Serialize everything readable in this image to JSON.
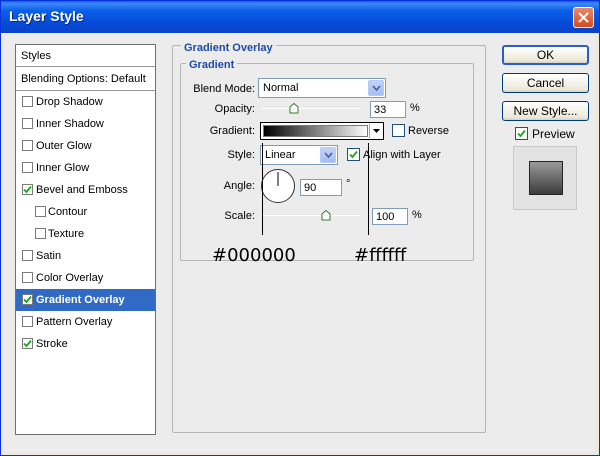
{
  "window": {
    "title": "Layer Style"
  },
  "styles_list": {
    "header": "Styles",
    "blending": "Blending Options: Default",
    "items": [
      {
        "label": "Drop Shadow",
        "checked": false,
        "sub": false,
        "selected": false
      },
      {
        "label": "Inner Shadow",
        "checked": false,
        "sub": false,
        "selected": false
      },
      {
        "label": "Outer Glow",
        "checked": false,
        "sub": false,
        "selected": false
      },
      {
        "label": "Inner Glow",
        "checked": false,
        "sub": false,
        "selected": false
      },
      {
        "label": "Bevel and Emboss",
        "checked": true,
        "sub": false,
        "selected": false
      },
      {
        "label": "Contour",
        "checked": false,
        "sub": true,
        "selected": false
      },
      {
        "label": "Texture",
        "checked": false,
        "sub": true,
        "selected": false
      },
      {
        "label": "Satin",
        "checked": false,
        "sub": false,
        "selected": false
      },
      {
        "label": "Color Overlay",
        "checked": false,
        "sub": false,
        "selected": false
      },
      {
        "label": "Gradient Overlay",
        "checked": true,
        "sub": false,
        "selected": true
      },
      {
        "label": "Pattern Overlay",
        "checked": false,
        "sub": false,
        "selected": false
      },
      {
        "label": "Stroke",
        "checked": true,
        "sub": false,
        "selected": false
      }
    ]
  },
  "gradient_overlay": {
    "group_title": "Gradient Overlay",
    "section_title": "Gradient",
    "blend_mode_label": "Blend Mode:",
    "blend_mode_value": "Normal",
    "opacity_label": "Opacity:",
    "opacity_value": "33",
    "opacity_unit": "%",
    "gradient_label": "Gradient:",
    "reverse_label": "Reverse",
    "reverse_checked": false,
    "style_label": "Style:",
    "style_value": "Linear",
    "align_label": "Align with Layer",
    "align_checked": true,
    "angle_label": "Angle:",
    "angle_value": "90",
    "angle_unit": "°",
    "scale_label": "Scale:",
    "scale_value": "100",
    "scale_unit": "%",
    "gradient_start_color": "#000000",
    "gradient_end_color": "#ffffff"
  },
  "annotations": {
    "left_color": "#000000",
    "right_color": "#ffffff"
  },
  "buttons": {
    "ok": "OK",
    "cancel": "Cancel",
    "new_style": "New Style...",
    "preview_label": "Preview",
    "preview_checked": true
  },
  "colors": {
    "titlebar": "#0a5fe8",
    "selection": "#316ac5",
    "group_title": "#1c4aa6"
  }
}
